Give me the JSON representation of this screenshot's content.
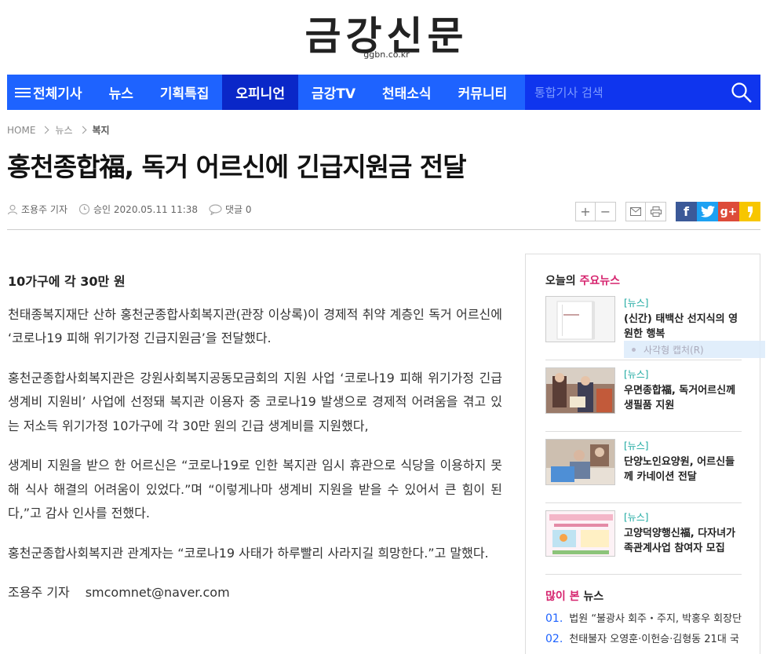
{
  "masthead": {
    "logo": "금강신문",
    "domain": "ggbn.co.kr"
  },
  "nav": {
    "items": [
      {
        "label": "전체기사"
      },
      {
        "label": "뉴스"
      },
      {
        "label": "기획특집"
      },
      {
        "label": "오피니언"
      },
      {
        "label": "금강TV"
      },
      {
        "label": "천태소식"
      },
      {
        "label": "커뮤니티"
      }
    ],
    "active": "오피니언",
    "search_placeholder": "통합기사 검색"
  },
  "breadcrumb": {
    "home": "HOME",
    "level1": "뉴스",
    "level2": "복지"
  },
  "article": {
    "headline": "홍천종합福, 독거 어르신에 긴급지원금 전달",
    "reporter": "조용주 기자",
    "approved": "승인 2020.05.11 11:38",
    "comments": "댓글 0",
    "subtitle": "10가구에 각 30만 원",
    "paragraphs": [
      "천태종복지재단 산하 홍천군종합사회복지관(관장 이상록)이 경제적 취약 계층인 독거 어르신에 ‘코로나19 피해 위기가정 긴급지원금’을 전달했다.",
      "홍천군종합사회복지관은 강원사회복지공동모금회의 지원 사업 ‘코로나19 피해 위기가정 긴급생계비 지원비’ 사업에 선정돼 복지관 이용자 중 코로나19 발생으로 경제적 어려움을 겪고 있는 저소득 위기가정 10가구에 각 30만 원의 긴급 생계비를 지원했다,",
      "생계비 지원을 받으 한 어르신은 “코로나19로 인한 복지관 임시 휴관으로 식당을 이용하지 못해 식사 해결의 어려움이 있었다.”며 “이렇게나마 생계비 지원을 받을 수 있어서 큰 힘이 된다,”고 감사 인사를 전했다.",
      "홍천군종합사회복지관 관계자는 “코로나19 사태가 하루빨리 사라지길 희망한다.”고 말했다."
    ],
    "byline_name": "조용주 기자",
    "byline_email": "smcomnet@naver.com"
  },
  "tools": {
    "plus": "+",
    "minus": "−",
    "fb": "f",
    "gplus": "g+"
  },
  "sidebar": {
    "top_title_a": "오늘의 ",
    "top_title_b": "주요뉴스",
    "news": [
      {
        "category": "[뉴스]",
        "title": "(신간) 태백산 선지식의 영원한 행복"
      },
      {
        "category": "[뉴스]",
        "title": "우면종합福, 독거어르신께 생필품 지원"
      },
      {
        "category": "[뉴스]",
        "title": "단양노인요양원, 어르신들께 카네이션 전달"
      },
      {
        "category": "[뉴스]",
        "title": "고양덕양행신福, 다자녀가족관계사업 참여자 모집"
      }
    ],
    "popular_title_a": "많이 본",
    "popular_title_b": " 뉴스",
    "popular": [
      {
        "num": "01.",
        "title": "법원 “불광사 회주・주지, 박홍우 회장단"
      },
      {
        "num": "02.",
        "title": "천태불자 오영훈·이헌승·김형동 21대 국"
      }
    ]
  },
  "overlay": {
    "text": "사각형 캡처(R)"
  },
  "colors": {
    "nav": "#1e63ff",
    "nav_active": "#0a27c8",
    "accent": "#d6246e",
    "category": "#1aa8a0"
  }
}
